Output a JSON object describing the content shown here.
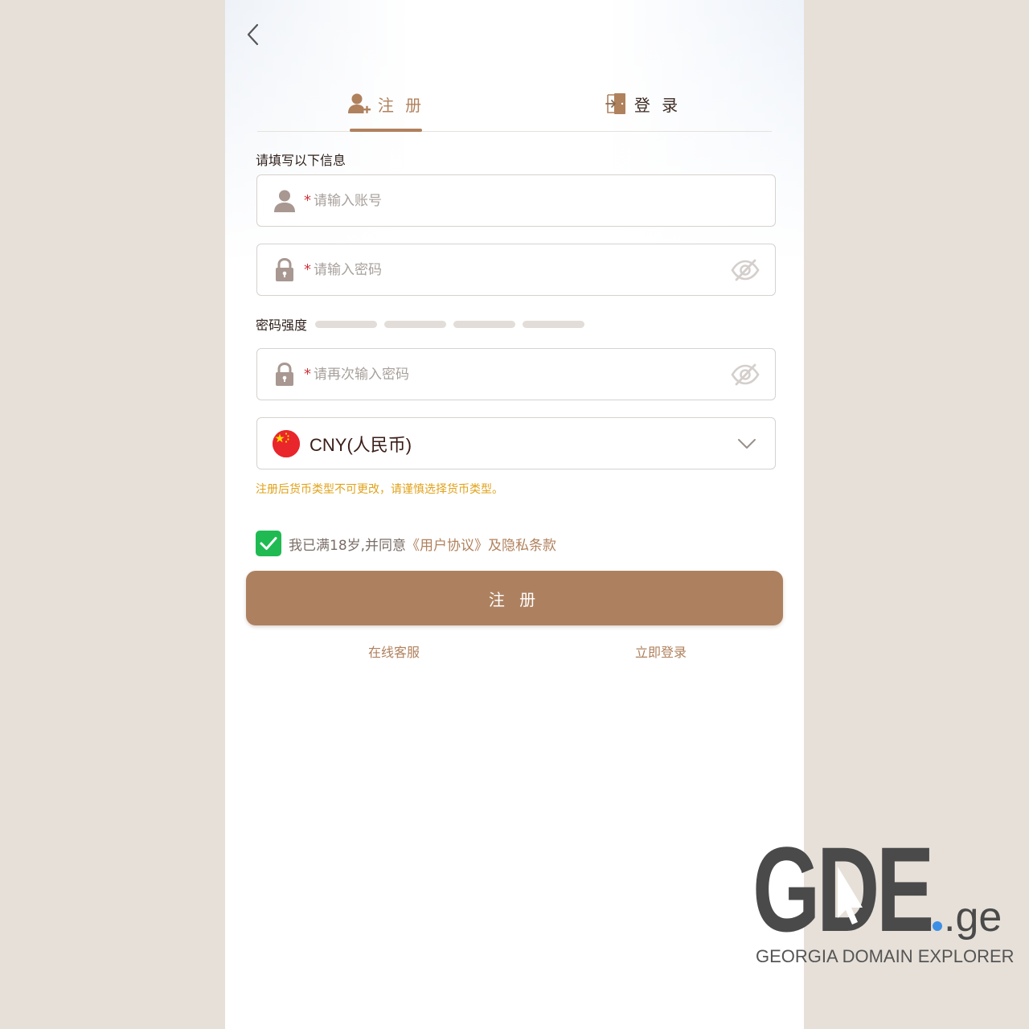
{
  "header": {
    "back_icon": "chevron-left-icon"
  },
  "tabs": [
    {
      "label": "注 册",
      "icon": "user-add-icon",
      "active": true
    },
    {
      "label": "登 录",
      "icon": "door-login-icon",
      "active": false
    }
  ],
  "form": {
    "section_title": "请填写以下信息",
    "username_placeholder": "请输入账号",
    "password_placeholder": "请输入密码",
    "strength_label": "密码强度",
    "confirm_placeholder": "请再次输入密码",
    "required_mark": "*",
    "currency": {
      "value": "CNY(人民币)",
      "flag": "china-flag-icon"
    },
    "currency_note": "注册后货币类型不可更改，请谨慎选择货币类型。",
    "agree_text": "我已满18岁,并同意",
    "agree_link": "《用户协议》及隐私条款",
    "submit_label": "注 册"
  },
  "links": {
    "left": "在线客服",
    "right": "立即登录"
  },
  "colors": {
    "accent": "#ad8160",
    "checkbox": "#1fbb52",
    "warning": "#e0a21a",
    "required": "#d0333b"
  },
  "watermark": {
    "logo_text": "GDE",
    "logo_suffix": ".ge",
    "caption": "GEORGIA DOMAIN EXPLORER"
  }
}
